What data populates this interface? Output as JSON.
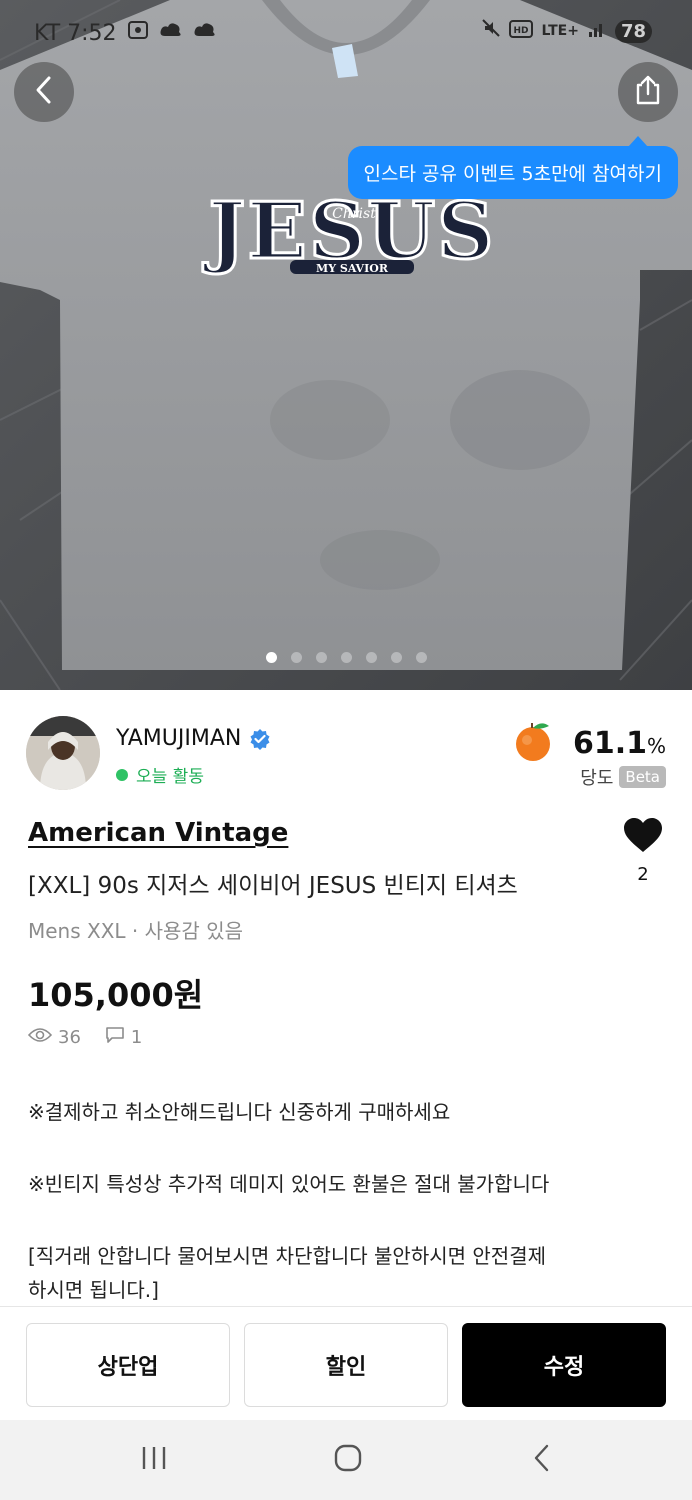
{
  "status_bar": {
    "carrier_time": "KT 7:52",
    "network": "LTE+",
    "battery": "78",
    "icons": [
      "screenshot-icon",
      "cloud-icon",
      "cloud-icon",
      "mute-icon",
      "hd-icon",
      "signal-icon"
    ]
  },
  "hero": {
    "tooltip": "인스타 공유 이벤트 5초만에 참여하기",
    "shirt_print_main": "JESUS",
    "shirt_print_script": "Christ",
    "shirt_print_banner": "MY SAVIOR",
    "dot_count": 7,
    "active_dot": 0
  },
  "seller": {
    "name": "YAMUJIMAN",
    "activity": "오늘 활동",
    "sweetness_value": "61.1",
    "sweetness_unit": "%",
    "sweetness_label": "당도",
    "beta_badge": "Beta"
  },
  "product": {
    "brand": "American Vintage",
    "title": "[XXL] 90s 지저스 세이비어 JESUS 빈티지 티셔츠",
    "like_count": "2",
    "meta": "Mens XXL · 사용감 있음",
    "price": "105,000원",
    "views": "36",
    "comments": "1"
  },
  "description": {
    "line1": "※결제하고 취소안해드립니다 신중하게 구매하세요",
    "line2": "※빈티지 특성상 추가적 데미지 있어도 환불은 절대 불가합니다",
    "line3a": "[직거래 안합니다 물어보시면 차단합니다 불안하시면 안전결제",
    "line3b": "하시면 됩니다.]"
  },
  "actions": {
    "bump": "상단업",
    "discount": "할인",
    "edit": "수정"
  },
  "colors": {
    "tooltip": "#1b8cff",
    "activity_green": "#1dae55",
    "verified_blue": "#3b8ee8",
    "primary_button": "#000000"
  }
}
